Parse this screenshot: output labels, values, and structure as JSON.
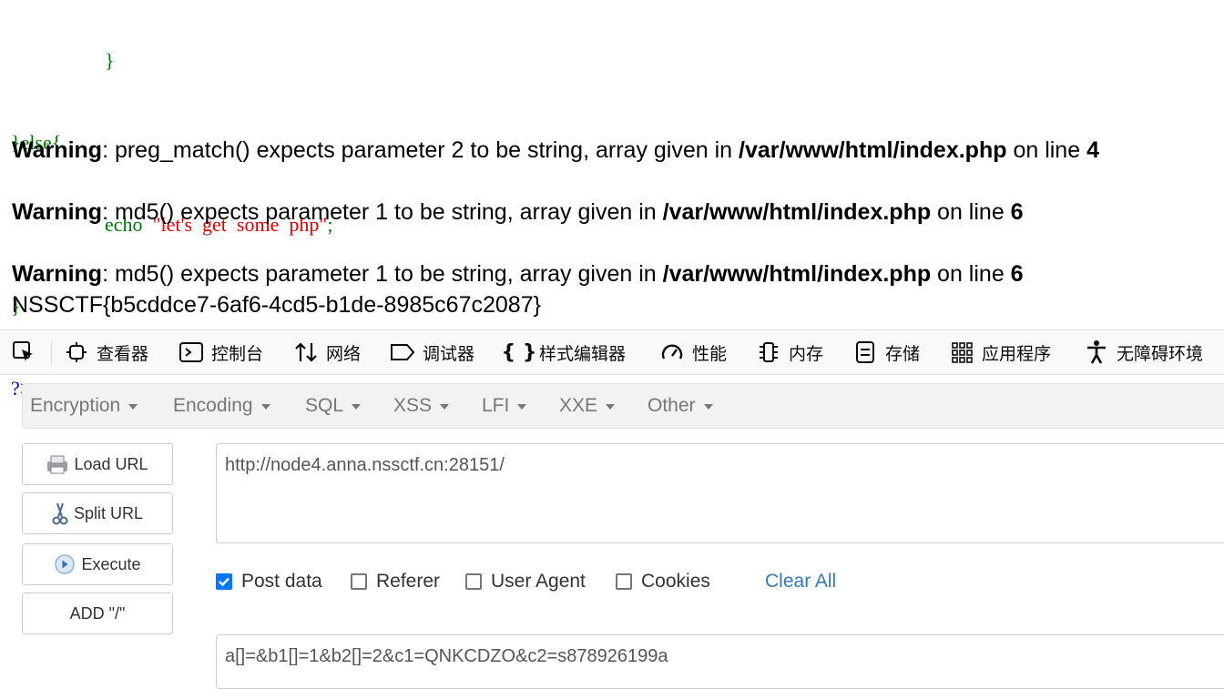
{
  "source_code": {
    "line1": "}",
    "line2": "}else{",
    "echo_keyword": "echo",
    "echo_string": "\"let's  get  some  php\"",
    "echo_semicolon": ";",
    "line4": "}",
    "close_tag": "?>"
  },
  "warnings": [
    {
      "label": "Warning",
      "message": ": preg_match() expects parameter 2 to be string, array given in ",
      "file": "/var/www/html/index.php",
      "on_line": " on line ",
      "line": "4"
    },
    {
      "label": "Warning",
      "message": ": md5() expects parameter 1 to be string, array given in ",
      "file": "/var/www/html/index.php",
      "on_line": " on line ",
      "line": "6"
    },
    {
      "label": "Warning",
      "message": ": md5() expects parameter 1 to be string, array given in ",
      "file": "/var/www/html/index.php",
      "on_line": " on line ",
      "line": "6"
    }
  ],
  "flag": "NSSCTF{b5cddce7-6af6-4cd5-b1de-8985c67c2087}",
  "devtools": {
    "tabs": [
      {
        "label": "查看器",
        "icon": "inspector-icon"
      },
      {
        "label": "控制台",
        "icon": "console-icon"
      },
      {
        "label": "网络",
        "icon": "network-icon"
      },
      {
        "label": "调试器",
        "icon": "debugger-icon"
      },
      {
        "label": "样式编辑器",
        "icon": "style-editor-icon"
      },
      {
        "label": "性能",
        "icon": "performance-icon"
      },
      {
        "label": "内存",
        "icon": "memory-icon"
      },
      {
        "label": "存储",
        "icon": "storage-icon"
      },
      {
        "label": "应用程序",
        "icon": "application-icon"
      },
      {
        "label": "无障碍环境",
        "icon": "accessibility-icon"
      }
    ]
  },
  "hackbar": {
    "menus": [
      "Encryption",
      "Encoding",
      "SQL",
      "XSS",
      "LFI",
      "XXE",
      "Other"
    ],
    "buttons": {
      "load_url": "Load URL",
      "split_url": "Split URL",
      "execute": "Execute",
      "add_slash": "ADD \"/\""
    },
    "url": "http://node4.anna.nssctf.cn:28151/",
    "options": [
      {
        "label": "Post data",
        "checked": true
      },
      {
        "label": "Referer",
        "checked": false
      },
      {
        "label": "User Agent",
        "checked": false
      },
      {
        "label": "Cookies",
        "checked": false
      }
    ],
    "clear_all": "Clear All",
    "post_data": "a[]=&b1[]=1&b2[]=2&c1=QNKCDZO&c2=s878926199a"
  },
  "colors": {
    "php_keyword": "#007700",
    "php_string": "#dd0000",
    "php_tag": "#0000bb",
    "checkbox_checked": "#0075ff",
    "link": "#337ab7"
  }
}
